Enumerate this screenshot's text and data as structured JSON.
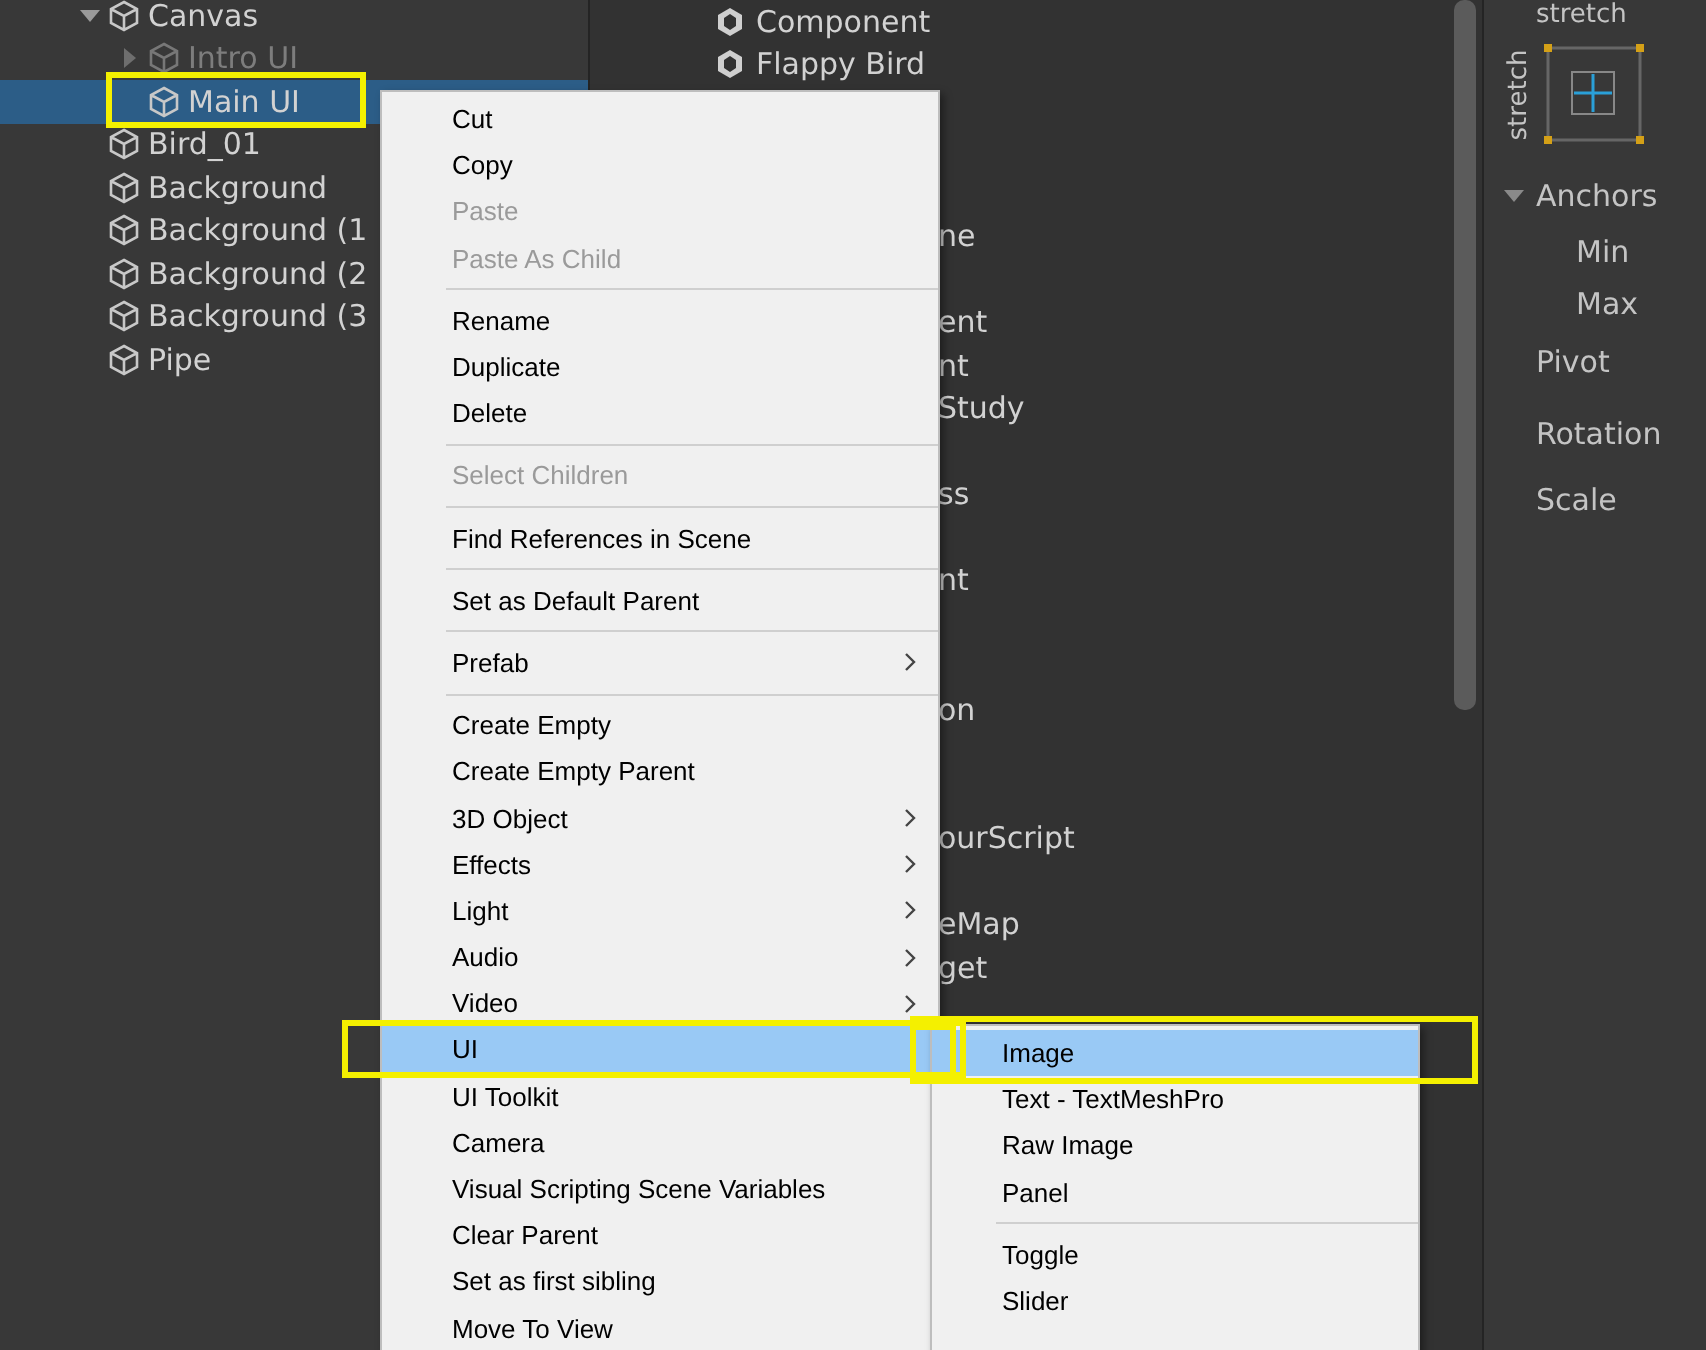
{
  "hierarchy": {
    "items": [
      {
        "label": "Canvas",
        "expanded": true,
        "active": true,
        "selected": false,
        "children": [
          {
            "label": "Intro UI",
            "expanded": false,
            "active": false,
            "selected": false
          },
          {
            "label": "Main UI",
            "active": true,
            "selected": true
          }
        ]
      },
      {
        "label": "Bird_01",
        "active": true,
        "selected": false
      },
      {
        "label": "Background",
        "active": true,
        "selected": false
      },
      {
        "label": "Background (1",
        "active": true,
        "selected": false
      },
      {
        "label": "Background (2",
        "active": true,
        "selected": false
      },
      {
        "label": "Background (3",
        "active": true,
        "selected": false
      },
      {
        "label": "Pipe",
        "active": true,
        "selected": false
      }
    ]
  },
  "project": {
    "rows": [
      {
        "kind": "asset",
        "label": "Component"
      },
      {
        "kind": "asset",
        "label": "Flappy Bird"
      },
      {
        "kind": "hidden"
      },
      {
        "kind": "hidden"
      },
      {
        "kind": "hidden"
      },
      {
        "kind": "fragment",
        "label": "ne"
      },
      {
        "kind": "hidden"
      },
      {
        "kind": "fragment",
        "label": "ent"
      },
      {
        "kind": "fragment",
        "label": "nt"
      },
      {
        "kind": "fragment",
        "label": "Study"
      },
      {
        "kind": "hidden"
      },
      {
        "kind": "fragment",
        "label": "ss"
      },
      {
        "kind": "hidden"
      },
      {
        "kind": "fragment",
        "label": "nt"
      },
      {
        "kind": "hidden"
      },
      {
        "kind": "hidden"
      },
      {
        "kind": "fragment",
        "label": "on"
      },
      {
        "kind": "hidden"
      },
      {
        "kind": "hidden"
      },
      {
        "kind": "fragment",
        "label": "ourScript"
      },
      {
        "kind": "hidden"
      },
      {
        "kind": "fragment",
        "label": "eMap"
      },
      {
        "kind": "fragment",
        "label": "get"
      }
    ]
  },
  "inspector": {
    "anchor_preset": {
      "horizontal": "stretch",
      "vertical": "stretch"
    },
    "anchors": {
      "label": "Anchors",
      "expanded": true,
      "fields": [
        "Min",
        "Max"
      ]
    },
    "fields": [
      "Pivot",
      "Rotation",
      "Scale"
    ]
  },
  "context_menu": {
    "items": [
      {
        "kind": "item",
        "label": "Cut",
        "selected": false,
        "submenu": false
      },
      {
        "kind": "item",
        "label": "Copy",
        "selected": false,
        "submenu": false
      },
      {
        "kind": "item",
        "label": "Paste",
        "disabled": true,
        "selected": false,
        "submenu": false
      },
      {
        "kind": "item",
        "label": "Paste As Child",
        "disabled": true,
        "selected": false,
        "submenu": false
      },
      {
        "kind": "separator"
      },
      {
        "kind": "item",
        "label": "Rename",
        "selected": false,
        "submenu": false
      },
      {
        "kind": "item",
        "label": "Duplicate",
        "selected": false,
        "submenu": false
      },
      {
        "kind": "item",
        "label": "Delete",
        "selected": false,
        "submenu": false
      },
      {
        "kind": "separator"
      },
      {
        "kind": "item",
        "label": "Select Children",
        "disabled": true,
        "selected": false,
        "submenu": false
      },
      {
        "kind": "separator"
      },
      {
        "kind": "item",
        "label": "Find References in Scene",
        "selected": false,
        "submenu": false
      },
      {
        "kind": "separator"
      },
      {
        "kind": "item",
        "label": "Set as Default Parent",
        "selected": false,
        "submenu": false
      },
      {
        "kind": "separator"
      },
      {
        "kind": "item",
        "label": "Prefab",
        "disabled": false,
        "selected": false,
        "submenu": true
      },
      {
        "kind": "separator"
      },
      {
        "kind": "item",
        "label": "Create Empty",
        "disabled": false,
        "selected": false,
        "submenu": false
      },
      {
        "kind": "item",
        "label": "Create Empty Parent",
        "disabled": false,
        "selected": false,
        "submenu": false
      },
      {
        "kind": "item",
        "label": "3D Object",
        "disabled": false,
        "selected": false,
        "submenu": true
      },
      {
        "kind": "item",
        "label": "Effects",
        "disabled": false,
        "selected": false,
        "submenu": true
      },
      {
        "kind": "item",
        "label": "Light",
        "disabled": false,
        "selected": false,
        "submenu": true
      },
      {
        "kind": "item",
        "label": "Audio",
        "disabled": false,
        "selected": false,
        "submenu": true
      },
      {
        "kind": "item",
        "label": "Video",
        "disabled": false,
        "selected": false,
        "submenu": true
      },
      {
        "kind": "item",
        "label": "UI",
        "disabled": false,
        "selected": true,
        "submenu": false
      },
      {
        "kind": "item",
        "label": "UI Toolkit",
        "disabled": false,
        "selected": false,
        "submenu": false
      },
      {
        "kind": "item",
        "label": "Camera",
        "disabled": false,
        "selected": false,
        "submenu": false
      },
      {
        "kind": "item",
        "label": "Visual Scripting Scene Variables",
        "disabled": false,
        "selected": false,
        "submenu": false
      },
      {
        "kind": "item",
        "label": "Clear Parent",
        "disabled": false,
        "selected": false,
        "submenu": false
      },
      {
        "kind": "item",
        "label": "Set as first sibling",
        "disabled": false,
        "selected": false,
        "submenu": false
      },
      {
        "kind": "item",
        "label": "Move To View",
        "disabled": false,
        "selected": false,
        "submenu": false
      }
    ]
  },
  "submenu": {
    "items": [
      {
        "kind": "item",
        "label": "Image",
        "selected": true
      },
      {
        "kind": "item",
        "label": "Text - TextMeshPro",
        "selected": false
      },
      {
        "kind": "item",
        "label": "Raw Image",
        "selected": false
      },
      {
        "kind": "item",
        "label": "Panel",
        "selected": false
      },
      {
        "kind": "separator"
      },
      {
        "kind": "item",
        "label": "Toggle",
        "selected": false
      },
      {
        "kind": "item",
        "label": "Slider",
        "selected": false
      }
    ]
  }
}
